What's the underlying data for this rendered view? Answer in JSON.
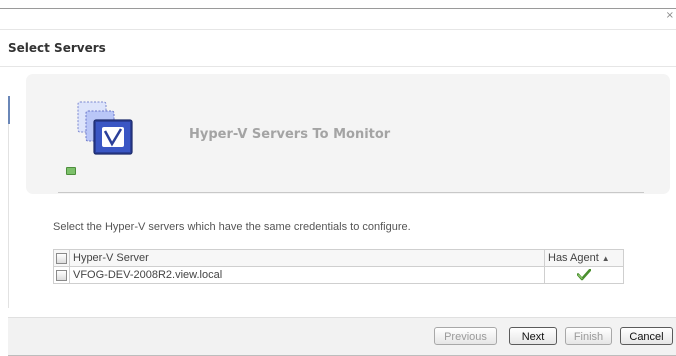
{
  "dialog": {
    "title": "Select Servers",
    "close_glyph": "×"
  },
  "header": {
    "title": "Hyper-V Servers To Monitor",
    "icon": "hyper-v-servers-icon",
    "status_indicator": "green"
  },
  "instruction": "Select the Hyper-V servers which have the same credentials to configure.",
  "table": {
    "columns": [
      "Hyper-V Server",
      "Has Agent"
    ],
    "sort_indicator": "▲",
    "rows": [
      {
        "server": "VFOG-DEV-2008R2.view.local",
        "has_agent": true,
        "selected": false
      }
    ]
  },
  "buttons": {
    "previous": "Previous",
    "next": "Next",
    "finish": "Finish",
    "cancel": "Cancel"
  },
  "colors": {
    "accent": "#6a87b8",
    "header_text": "#a4a4a4",
    "status_green": "#7cc06a"
  }
}
